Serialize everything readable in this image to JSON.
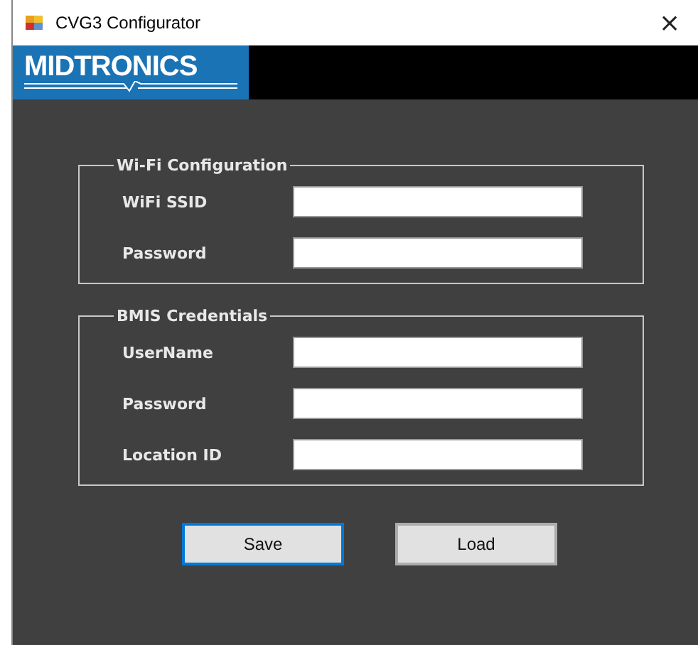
{
  "window": {
    "title": "CVG3 Configurator",
    "close": "×"
  },
  "logo": {
    "text": "MIDTRONICS"
  },
  "groups": [
    {
      "title": "Wi-Fi Configuration",
      "fields": [
        {
          "label": "WiFi SSID"
        },
        {
          "label": "Password"
        }
      ]
    },
    {
      "title": "BMIS Credentials",
      "fields": [
        {
          "label": "UserName"
        },
        {
          "label": "Password"
        },
        {
          "label": "Location ID"
        }
      ]
    }
  ],
  "buttons": [
    {
      "label": "Save",
      "focused": true
    },
    {
      "label": "Load",
      "focused": false
    }
  ]
}
